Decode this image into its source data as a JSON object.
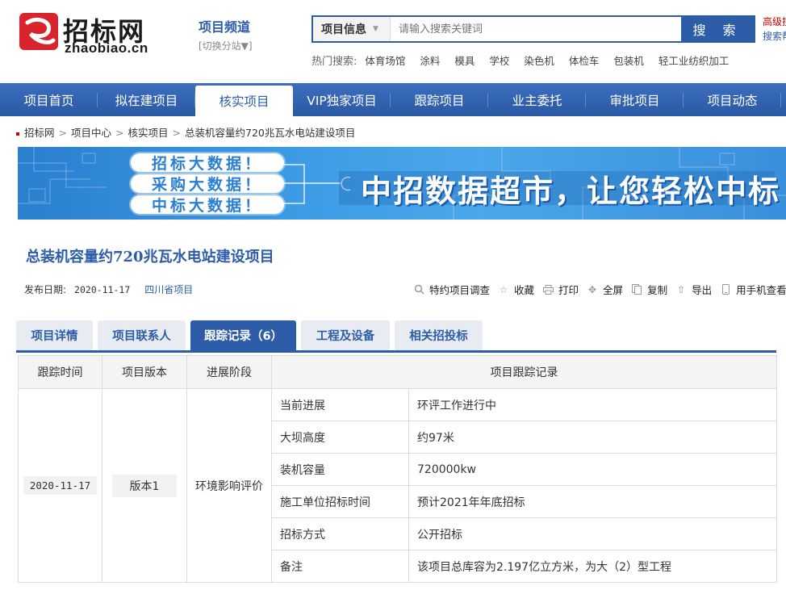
{
  "header": {
    "logo_cn": "招标网",
    "logo_en": "zhaobiao.cn",
    "channel_title": "项目频道",
    "channel_switch": "[切换分站▼]",
    "search_category": "项目信息",
    "search_placeholder": "请输入搜索关键词",
    "search_button": "搜 索",
    "side_link_1": "高级搜",
    "side_link_2": "搜索帮",
    "hot_label": "热门搜索:",
    "hot_terms": [
      "体育场馆",
      "涂料",
      "模具",
      "学校",
      "染色机",
      "体检车",
      "包装机",
      "轻工业纺织加工"
    ]
  },
  "nav": {
    "items": [
      "项目首页",
      "拟在建项目",
      "核实项目",
      "VIP独家项目",
      "跟踪项目",
      "业主委托",
      "审批项目",
      "项目动态"
    ],
    "active_index": 2
  },
  "breadcrumb": [
    "招标网",
    "项目中心",
    "核实项目",
    "总装机容量约720兆瓦水电站建设项目"
  ],
  "banner": {
    "pills": [
      "招标大数据！",
      "采购大数据！",
      "中标大数据！"
    ],
    "headline": "中招数据超市，让您轻松中标"
  },
  "project": {
    "title": "总装机容量约720兆瓦水电站建设项目",
    "date_label": "发布日期:",
    "date": "2020-11-17",
    "region": "四川省项目"
  },
  "actions": [
    {
      "icon": "search-icon",
      "label": "特约项目调查"
    },
    {
      "icon": "star-icon",
      "label": "收藏"
    },
    {
      "icon": "print-icon",
      "label": "打印"
    },
    {
      "icon": "fullscreen-icon",
      "label": "全屏"
    },
    {
      "icon": "copy-icon",
      "label": "复制"
    },
    {
      "icon": "export-icon",
      "label": "导出"
    },
    {
      "icon": "mobile-icon",
      "label": "用手机查看"
    }
  ],
  "tabs": [
    "项目详情",
    "项目联系人",
    "跟踪记录（6）",
    "工程及设备",
    "相关招投标"
  ],
  "active_tab": 2,
  "table": {
    "headers": [
      "跟踪时间",
      "项目版本",
      "进展阶段",
      "项目跟踪记录"
    ],
    "track_time": "2020-11-17",
    "version": "版本1",
    "stage": "环境影响评价",
    "rows": [
      {
        "key": "当前进展",
        "value": "环评工作进行中"
      },
      {
        "key": "大坝高度",
        "value": "约97米"
      },
      {
        "key": "装机容量",
        "value": "720000kw"
      },
      {
        "key": "施工单位招标时间",
        "value": "预计2021年年底招标"
      },
      {
        "key": "招标方式",
        "value": "公开招标"
      },
      {
        "key": "备注",
        "value": "该项目总库容为2.197亿立方米，为大（2）型工程"
      }
    ]
  },
  "colors": {
    "brand_blue": "#2d5ca8",
    "logo_red": "#d9232d"
  }
}
